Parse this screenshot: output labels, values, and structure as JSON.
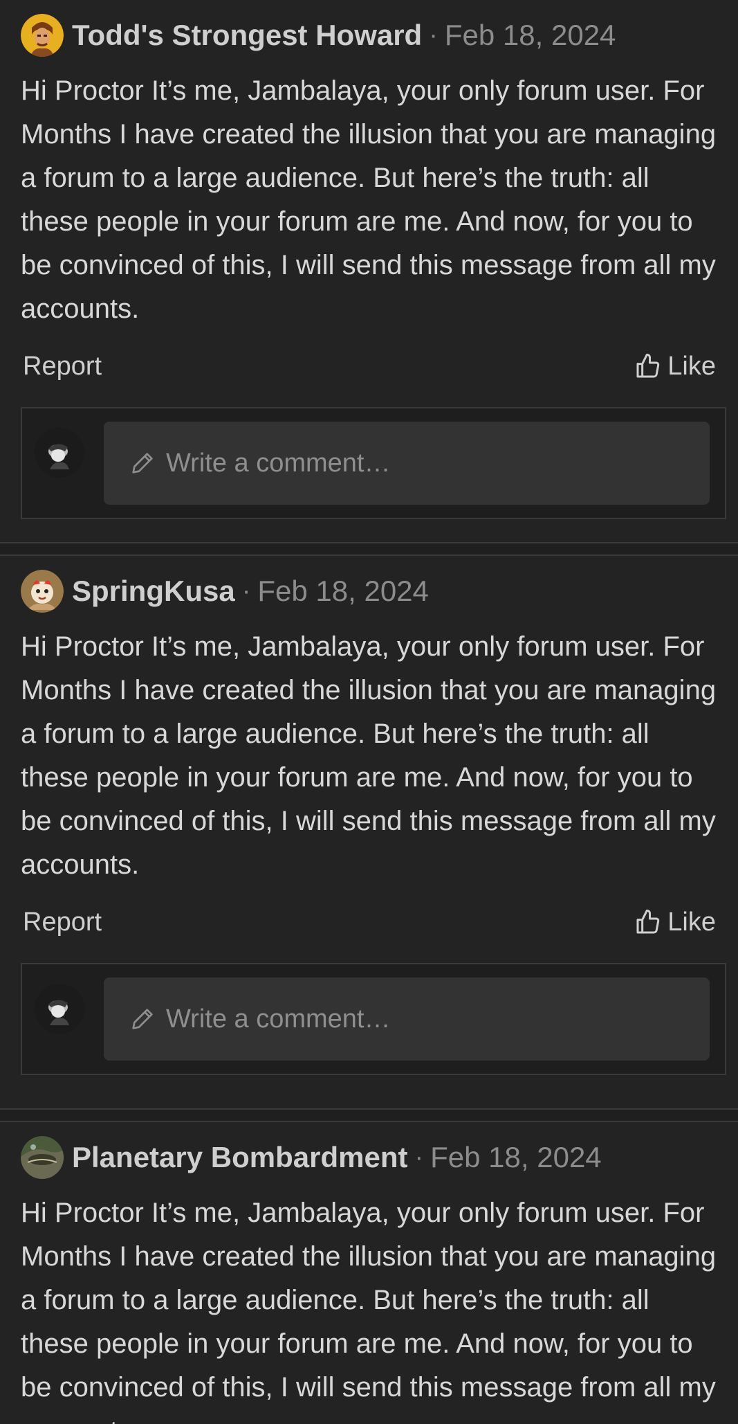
{
  "posts": [
    {
      "username": "Todd's Strongest Howard",
      "separator": "·",
      "date": "Feb 18, 2024",
      "body": "Hi Proctor It’s me, Jambalaya, your only forum user. For Months I have created the illusion that you are managing a forum to a large audience. But here’s the truth: all these people in your forum are me. And now, for you to be convinced of this, I will send this message from all my accounts.",
      "report_label": "Report",
      "like_label": "Like",
      "comment_placeholder": "Write a comment…",
      "avatar_icon": "avatar-howard"
    },
    {
      "username": "SpringKusa",
      "separator": "·",
      "date": "Feb 18, 2024",
      "body": "Hi Proctor It’s me, Jambalaya, your only forum user. For Months I have created the illusion that you are managing a forum to a large audience. But here’s the truth: all these people in your forum are me. And now, for you to be convinced of this, I will send this message from all my accounts.",
      "report_label": "Report",
      "like_label": "Like",
      "comment_placeholder": "Write a comment…",
      "avatar_icon": "avatar-springkusa"
    },
    {
      "username": "Planetary Bombardment",
      "separator": "·",
      "date": "Feb 18, 2024",
      "body": "Hi Proctor It’s me, Jambalaya, your only forum user. For Months I have created the illusion that you are managing a forum to a large audience. But here’s the truth: all these people in your forum are me. And now, for you to be convinced of this, I will send this message from all my accounts.",
      "avatar_icon": "avatar-planetary"
    }
  ],
  "colors": {
    "background": "#1f1f1f",
    "post_background": "#232323",
    "input_background": "#333333",
    "text": "#d8d8d8",
    "muted": "#8c8c8c"
  }
}
